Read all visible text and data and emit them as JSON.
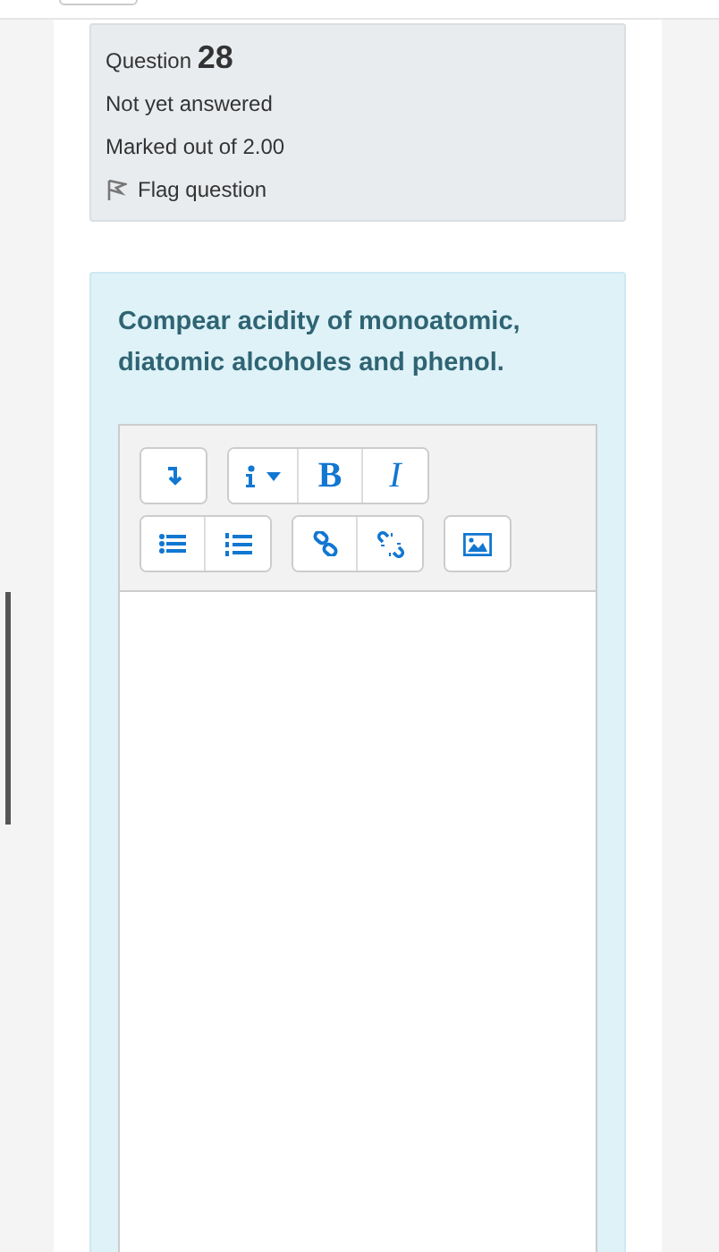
{
  "question": {
    "label": "Question",
    "number": "28",
    "status": "Not yet answered",
    "mark": "Marked out of 2.00",
    "flag": "Flag question"
  },
  "prompt": "Compear acidity of monoatomic, diatomic alcoholes and phenol.",
  "toolbar_rows": [
    {
      "groups": [
        [
          {
            "kind": "collapse"
          }
        ],
        [
          {
            "kind": "info"
          },
          {
            "kind": "bold",
            "label": "B"
          },
          {
            "kind": "italic",
            "label": "I"
          }
        ]
      ]
    },
    {
      "groups": [
        [
          {
            "kind": "bullets"
          },
          {
            "kind": "numbers"
          }
        ],
        [
          {
            "kind": "link"
          },
          {
            "kind": "unlink"
          }
        ],
        [
          {
            "kind": "image"
          }
        ]
      ]
    }
  ]
}
